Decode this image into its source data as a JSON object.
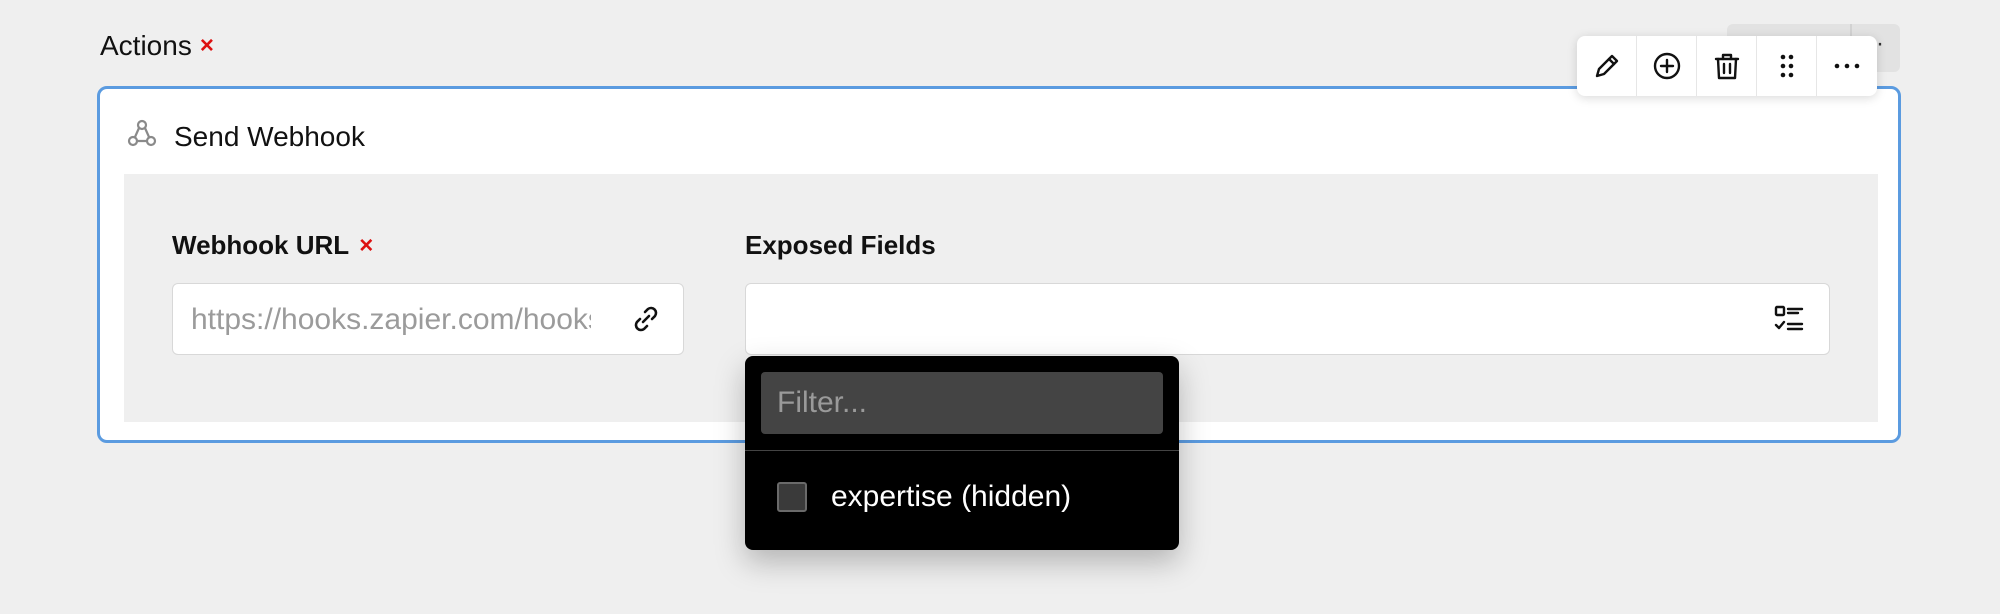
{
  "section": {
    "title": "Actions",
    "required_mark": "×"
  },
  "background_tab": {
    "more_label": "··"
  },
  "action_card": {
    "icon": "webhook-icon",
    "title": "Send Webhook",
    "toolbar": [
      {
        "name": "edit-button",
        "icon": "pencil-icon"
      },
      {
        "name": "add-button",
        "icon": "plus-circle-icon"
      },
      {
        "name": "delete-button",
        "icon": "trash-icon"
      },
      {
        "name": "drag-handle",
        "icon": "grip-dots-icon"
      },
      {
        "name": "more-button",
        "icon": "ellipsis-icon"
      }
    ]
  },
  "fields": {
    "webhook_url": {
      "label": "Webhook URL",
      "required_mark": "×",
      "placeholder": "https://hooks.zapier.com/hooks/catch/",
      "value": "",
      "icon": "link-icon"
    },
    "exposed_fields": {
      "label": "Exposed Fields",
      "value": "",
      "icon": "checklist-icon"
    }
  },
  "dropdown": {
    "filter_placeholder": "Filter...",
    "options": [
      {
        "label": "expertise (hidden)",
        "checked": false
      }
    ]
  },
  "colors": {
    "accent_border": "#5b9be0",
    "required": "#dd1111",
    "dropdown_bg": "#000000",
    "page_bg": "#efefef"
  }
}
